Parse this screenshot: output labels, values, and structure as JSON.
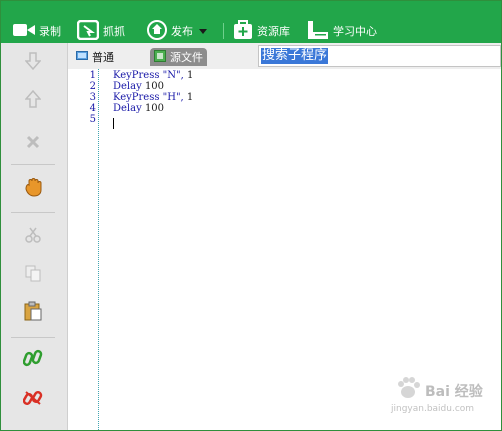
{
  "toolbar": {
    "record_label": "录制",
    "capture_label": "抓抓",
    "publish_label": "发布",
    "resource_label": "资源库",
    "learn_label": "学习中心"
  },
  "tabs": {
    "normal_label": "普通",
    "source_label": "源文件"
  },
  "search": {
    "value": "搜索子程序"
  },
  "editor": {
    "line_numbers": [
      "1",
      "2",
      "3",
      "4",
      "5"
    ],
    "lines": [
      {
        "kw": "KeyPress \"N\", ",
        "num": "1"
      },
      {
        "kw": "Delay ",
        "num": "100"
      },
      {
        "kw": "KeyPress \"H\", ",
        "num": "1"
      },
      {
        "kw": "Delay ",
        "num": "100"
      },
      {
        "kw": "",
        "num": ""
      }
    ]
  },
  "watermark": {
    "brand": "Bai 经验",
    "url": "jingyan.baidu.com"
  },
  "colors": {
    "toolbar_bg": "#22a64a",
    "code_blue": "#1a1aa8",
    "selection": "#3b78d8"
  }
}
